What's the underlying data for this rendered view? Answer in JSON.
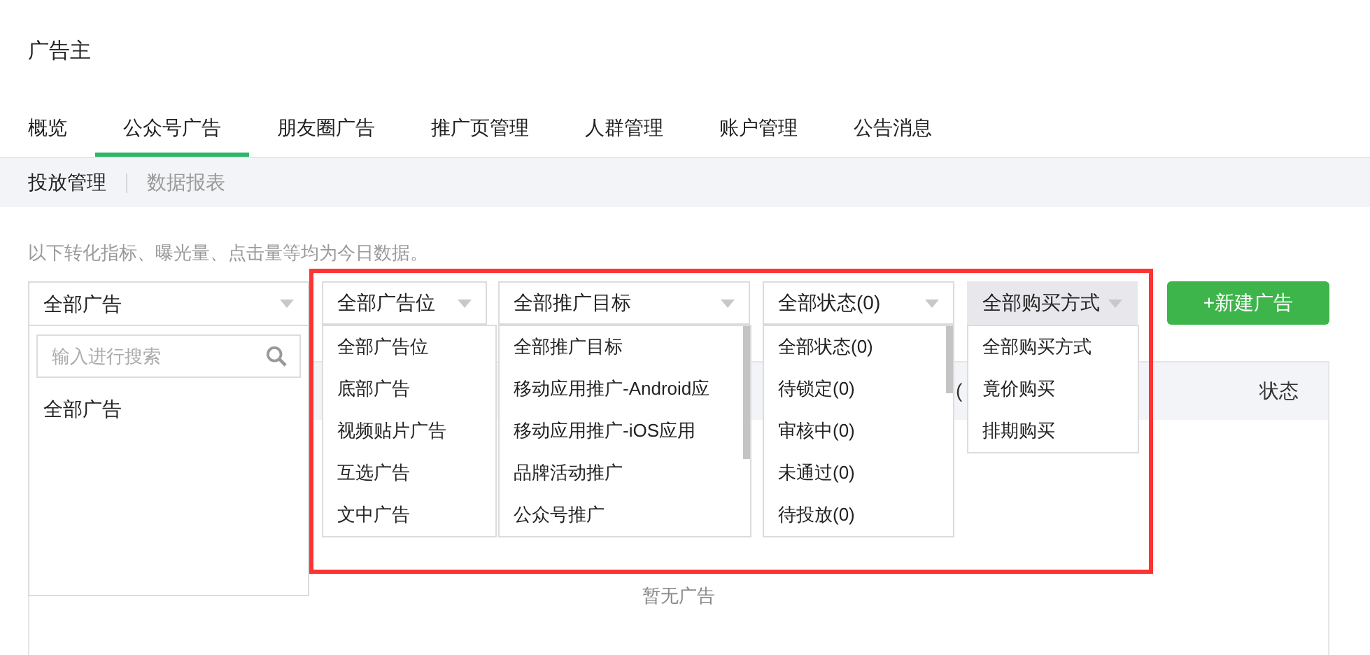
{
  "app_title": "广告主",
  "tabs": [
    {
      "label": "概览",
      "selected": false
    },
    {
      "label": "公众号广告",
      "selected": true
    },
    {
      "label": "朋友圈广告",
      "selected": false
    },
    {
      "label": "推广页管理",
      "selected": false
    },
    {
      "label": "人群管理",
      "selected": false
    },
    {
      "label": "账户管理",
      "selected": false
    },
    {
      "label": "公告消息",
      "selected": false
    }
  ],
  "subtabs": [
    {
      "label": "投放管理",
      "selected": true
    },
    {
      "label": "数据报表",
      "selected": false
    }
  ],
  "notice": "以下转化指标、曝光量、点击量等均为今日数据。",
  "ad_filter": {
    "value": "全部广告",
    "search": {
      "placeholder": "输入进行搜索"
    },
    "items": [
      "全部广告"
    ]
  },
  "filters": [
    {
      "value": "全部广告位",
      "highlighted": false,
      "scrollable": false,
      "options": [
        "全部广告位",
        "底部广告",
        "视频贴片广告",
        "互选广告",
        "文中广告"
      ]
    },
    {
      "value": "全部推广目标",
      "highlighted": false,
      "scrollable": true,
      "options": [
        "全部推广目标",
        "移动应用推广-Android应",
        "移动应用推广-iOS应用",
        "品牌活动推广",
        "公众号推广"
      ]
    },
    {
      "value": "全部状态(0)",
      "highlighted": false,
      "scrollable": true,
      "options": [
        "全部状态(0)",
        "待锁定(0)",
        "审核中(0)",
        "未通过(0)",
        "待投放(0)"
      ]
    },
    {
      "value": "全部购买方式",
      "highlighted": true,
      "scrollable": false,
      "options": [
        "全部购买方式",
        "竟价购买",
        "排期购买"
      ]
    }
  ],
  "new_ad_button": "+新建广告",
  "table": {
    "columns": [
      "(",
      "状态"
    ],
    "empty_text": "暂无广告"
  }
}
